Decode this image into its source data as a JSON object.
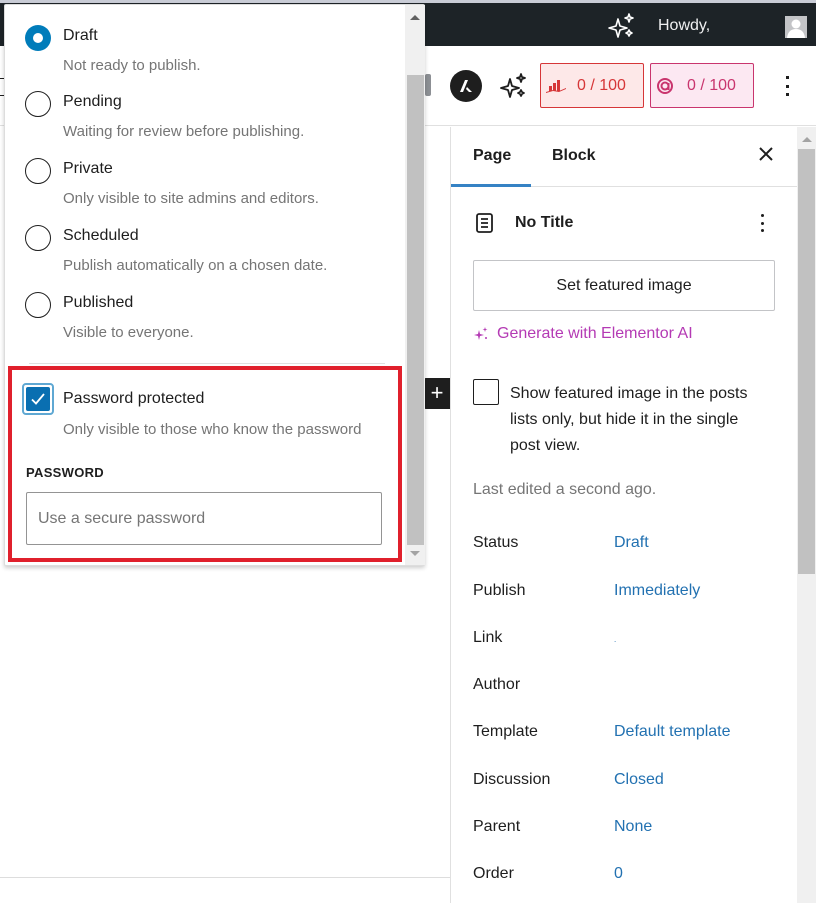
{
  "admin_bar": {
    "greeting": "Howdy,",
    "icons": [
      "ai-sparkle-icon",
      "avatar"
    ]
  },
  "header": {
    "seo_score": "0 / 100",
    "readability_score": "0 / 100",
    "colors": {
      "seo": "#d63638",
      "readability": "#c9356e"
    }
  },
  "status_popover": {
    "options": [
      {
        "label": "Draft",
        "description": "Not ready to publish.",
        "checked": true
      },
      {
        "label": "Pending",
        "description": "Waiting for review before publishing.",
        "checked": false
      },
      {
        "label": "Private",
        "description": "Only visible to site admins and editors.",
        "checked": false
      },
      {
        "label": "Scheduled",
        "description": "Publish automatically on a chosen date.",
        "checked": false
      },
      {
        "label": "Published",
        "description": "Visible to everyone.",
        "checked": false
      }
    ],
    "password_protected": {
      "label": "Password protected",
      "description": "Only visible to those who know the password",
      "checked": true,
      "field_label": "PASSWORD",
      "placeholder": "Use a secure password",
      "value": ""
    },
    "highlight_color": "#e0202c"
  },
  "canvas": {
    "inserter": "+"
  },
  "sidebar": {
    "tabs": [
      {
        "label": "Page",
        "active": true
      },
      {
        "label": "Block",
        "active": false
      }
    ],
    "document_title": "No Title",
    "featured_image_button": "Set featured image",
    "generate_ai_link": "Generate with Elementor AI",
    "show_featured_checkbox": {
      "label": "Show featured image in the posts lists only, but hide it in the single post view.",
      "checked": false
    },
    "last_edited": "Last edited a second ago.",
    "meta": [
      {
        "key": "Status",
        "value": "Draft"
      },
      {
        "key": "Publish",
        "value": "Immediately"
      },
      {
        "key": "Link",
        "value": "."
      },
      {
        "key": "Author",
        "value": ""
      },
      {
        "key": "Template",
        "value": "Default template"
      },
      {
        "key": "Discussion",
        "value": "Closed"
      },
      {
        "key": "Parent",
        "value": "None"
      },
      {
        "key": "Order",
        "value": "0"
      }
    ],
    "accent_color": "#2271b1"
  }
}
